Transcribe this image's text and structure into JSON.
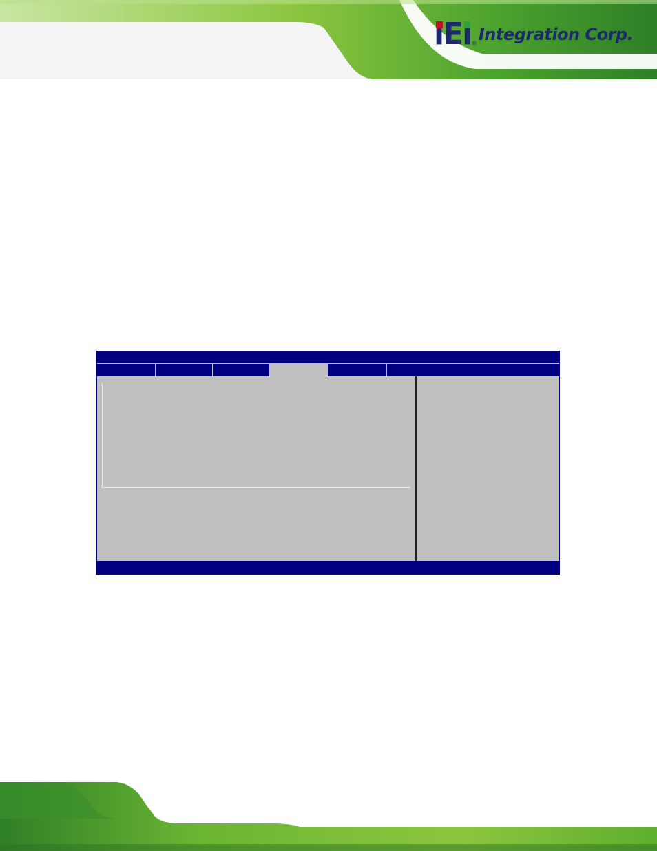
{
  "header": {
    "logo": {
      "mark": "iEi",
      "name": "Integration Corp."
    }
  },
  "bios": {
    "title": "",
    "tabs": [
      {
        "label": ""
      },
      {
        "label": ""
      },
      {
        "label": ""
      },
      {
        "label": "",
        "selected": true
      },
      {
        "label": ""
      },
      {
        "label": ""
      }
    ],
    "status_bar": ""
  },
  "colors": {
    "bios_blue": "#000080",
    "bios_gray": "#c0c0c0",
    "banner_green": "#7fc241",
    "logo_navy": "#1d2a6e"
  }
}
